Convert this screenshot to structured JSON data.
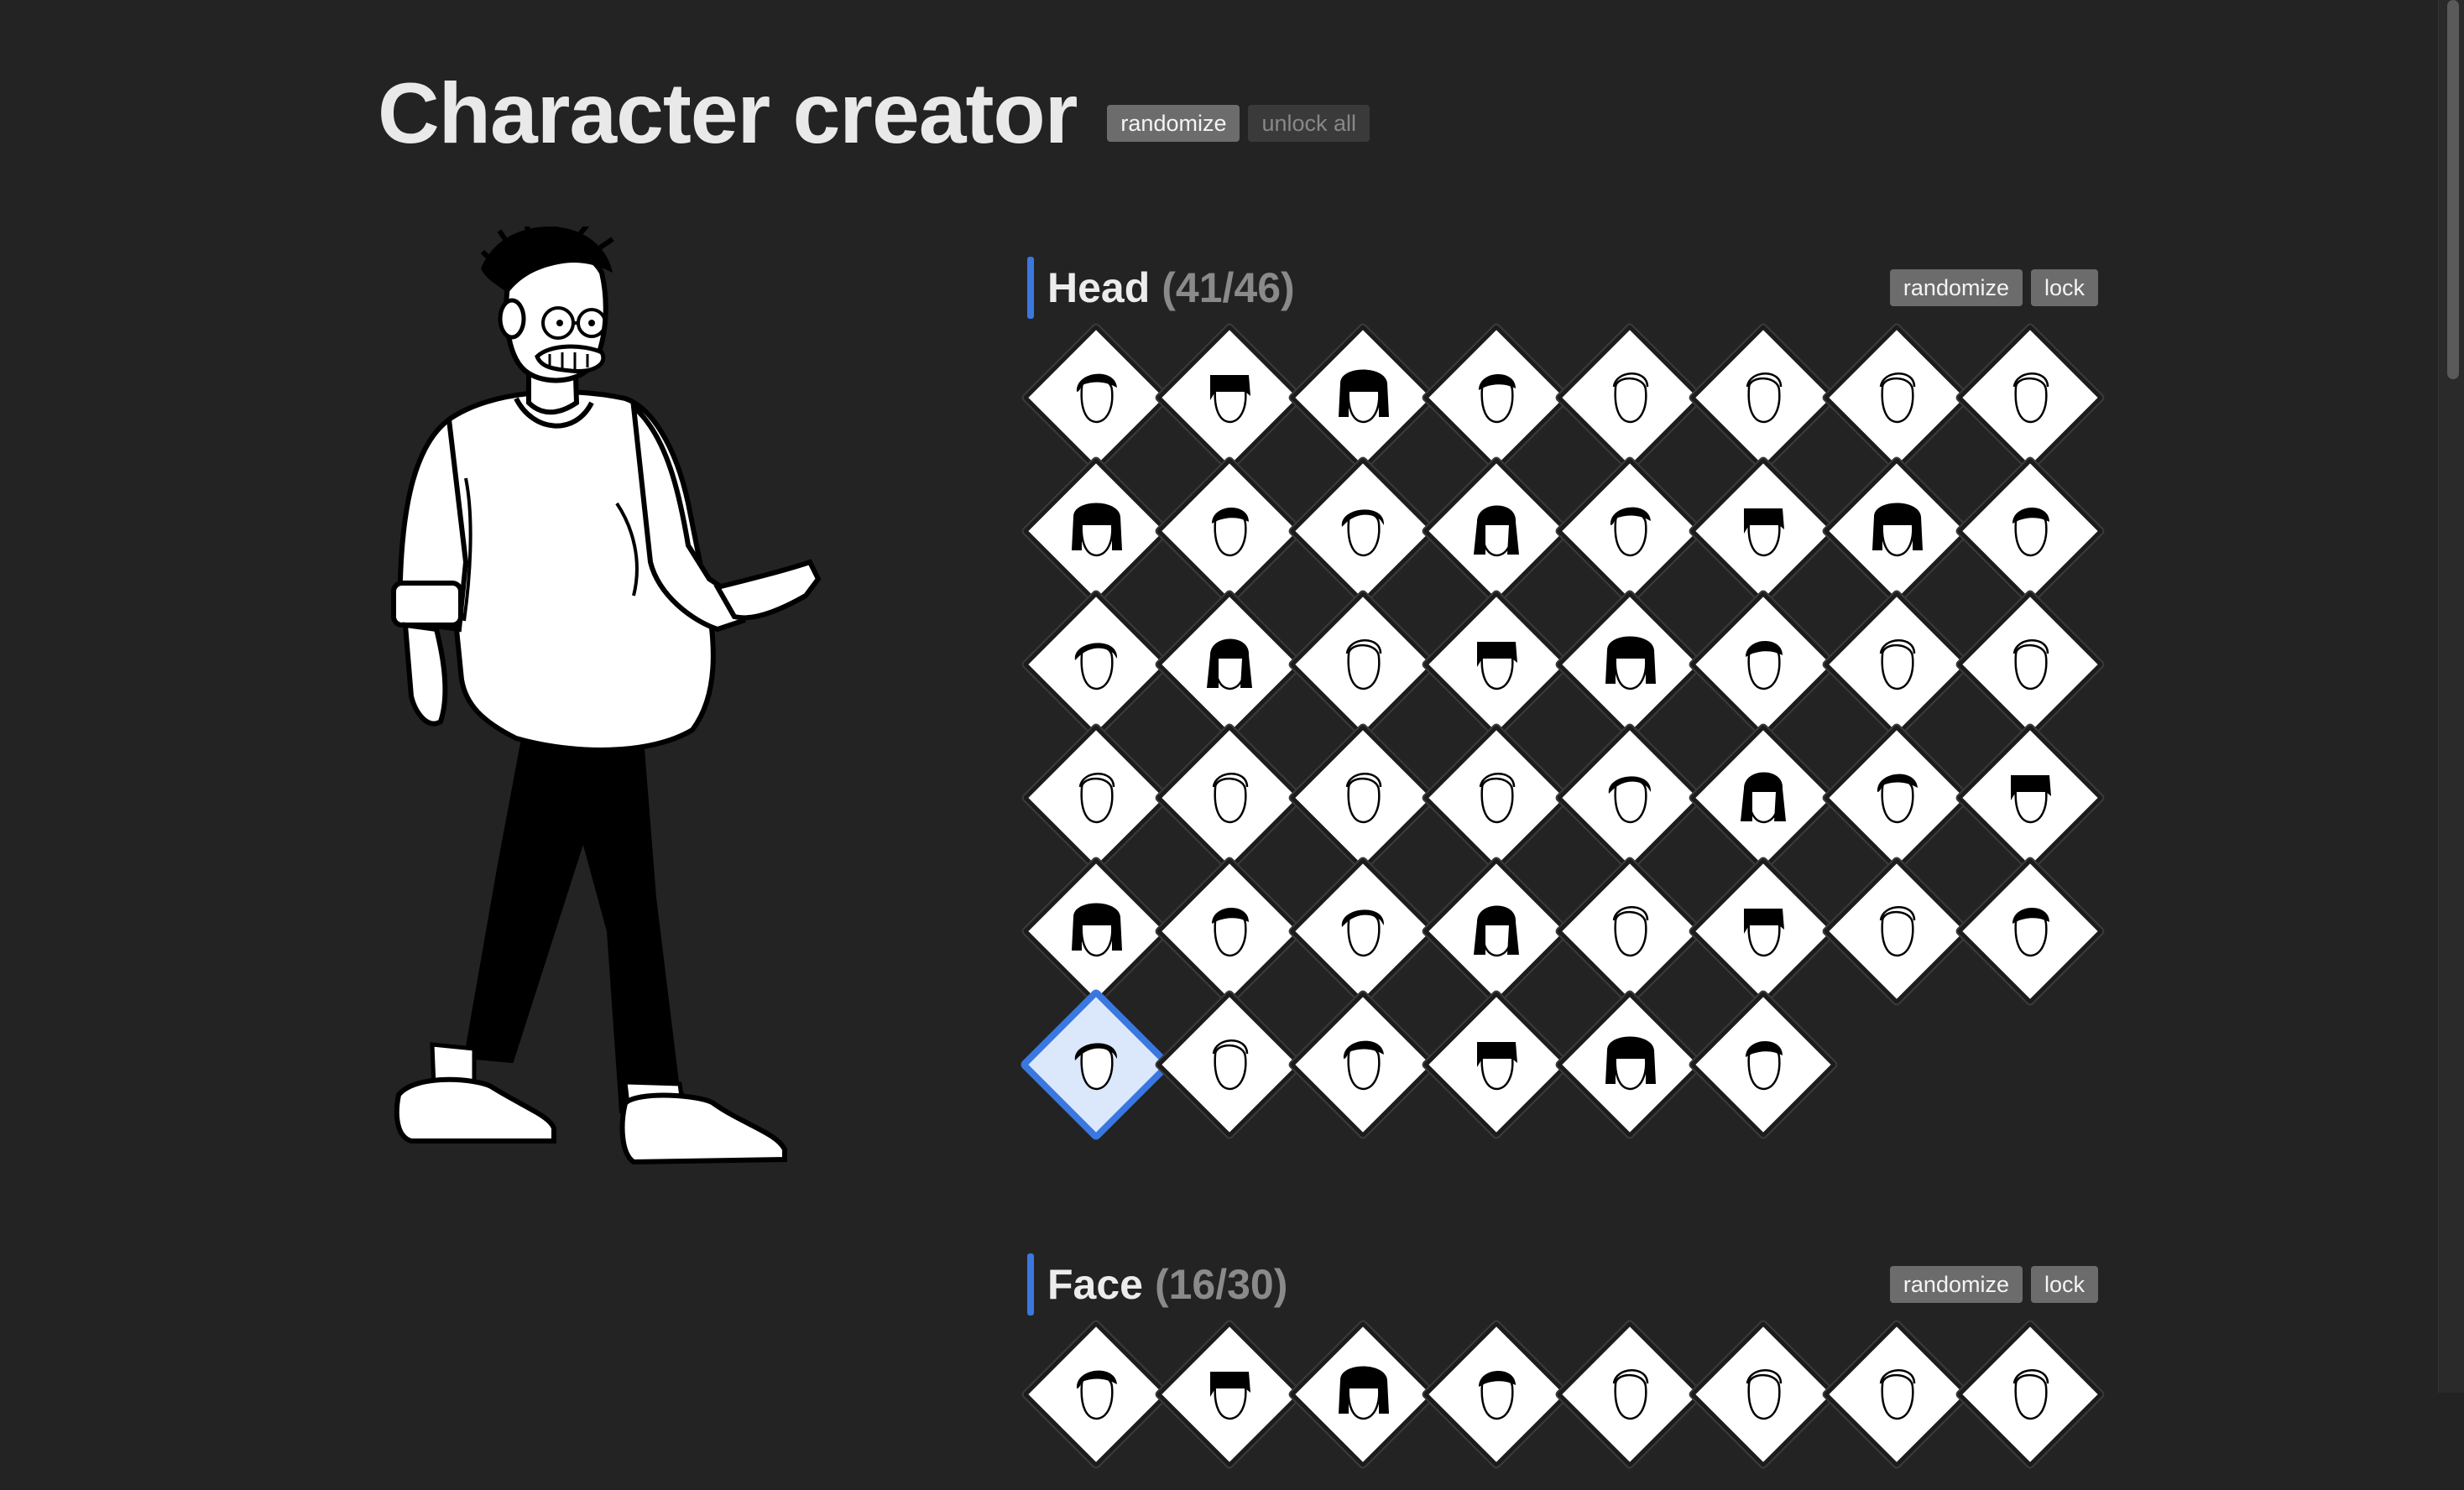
{
  "app": {
    "title": "Character creator"
  },
  "header": {
    "randomize_label": "randomize",
    "unlock_all_label": "unlock all"
  },
  "colors": {
    "background": "#232323",
    "accent": "#3a78e0",
    "button": "#6c6c6c"
  },
  "sections": [
    {
      "name": "Head",
      "count": "(41/46)",
      "randomize_label": "randomize",
      "lock_label": "lock",
      "tiles": 46,
      "selected_index": 40
    },
    {
      "name": "Face",
      "count": "(16/30)",
      "randomize_label": "randomize",
      "lock_label": "lock",
      "tiles_visible": 8
    }
  ],
  "head_hair_styles": [
    "short-cap",
    "ponytail",
    "flat-top",
    "buzz-side",
    "outline-bob",
    "outline-bun",
    "outline-short",
    "outline-shaved",
    "swept-bangs",
    "long-hood",
    "square-bob",
    "bowl-cut",
    "long-straight",
    "wide-bob",
    "side-part-long",
    "bob-short",
    "wavy-short",
    "long-wavy",
    "curly-outline",
    "long-bangs",
    "fringe-bob",
    "diagonal-long",
    "outline-long",
    "outline-buns",
    "outline-quiff",
    "bald",
    "outline-wisp",
    "outline-curl",
    "pompadour",
    "short-side",
    "short-crop",
    "messy-short",
    "side-part",
    "spiky",
    "comb-over",
    "slick-back",
    "outline-swoop",
    "short-fade",
    "turban",
    "flat-curly",
    "spiky-tall",
    "bald-beard",
    "undercut",
    "bandana",
    "space-buns",
    "dreads"
  ]
}
